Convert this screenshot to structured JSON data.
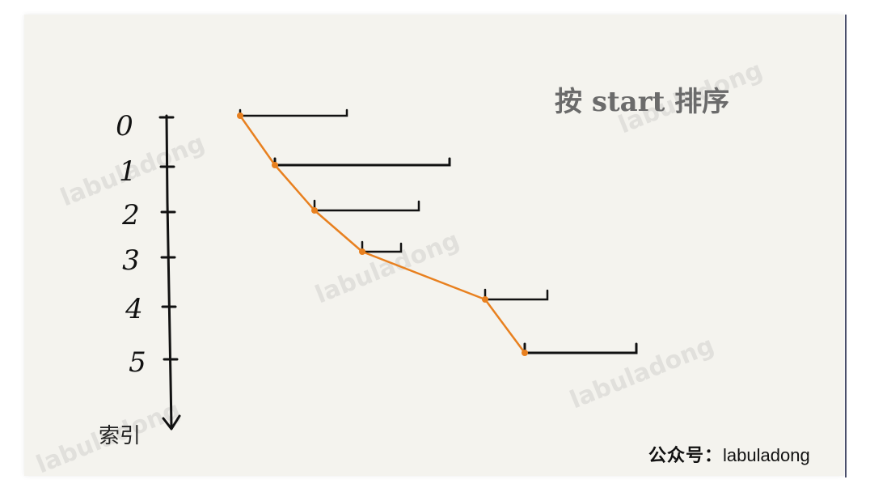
{
  "title": "按 start 排序",
  "axis": {
    "caption": "索引",
    "labels": [
      "0",
      "1",
      "2",
      "3",
      "4",
      "5"
    ]
  },
  "footer": {
    "prefix": "公众号：",
    "account": "labuladong"
  },
  "watermark": "labuladong",
  "colors": {
    "background": "#f4f3ee",
    "ink": "#111111",
    "path": "#e8801f",
    "title": "#6b6b6b"
  }
}
